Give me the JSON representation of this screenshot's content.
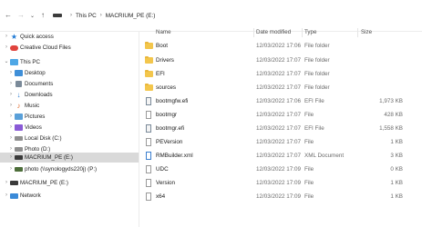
{
  "address": {
    "back_icon": "arrow-left-icon",
    "forward_icon": "arrow-right-icon",
    "recent_icon": "chevron-down-icon",
    "up_icon": "arrow-up-icon",
    "breadcrumb": [
      "This PC",
      "MACRIUM_PE (E:)"
    ]
  },
  "sidebar": {
    "items": [
      {
        "label": "Quick access",
        "icon": "star-icon",
        "expander": ">"
      },
      {
        "label": "Creative Cloud Files",
        "icon": "creative-cloud-icon",
        "expander": ">"
      },
      {
        "label": "This PC",
        "icon": "computer-icon",
        "expander": "v"
      },
      {
        "label": "Desktop",
        "icon": "desktop-folder-icon",
        "expander": ">"
      },
      {
        "label": "Documents",
        "icon": "documents-folder-icon",
        "expander": ">"
      },
      {
        "label": "Downloads",
        "icon": "downloads-icon",
        "expander": ">"
      },
      {
        "label": "Music",
        "icon": "music-icon",
        "expander": ">"
      },
      {
        "label": "Pictures",
        "icon": "pictures-folder-icon",
        "expander": ">"
      },
      {
        "label": "Videos",
        "icon": "videos-folder-icon",
        "expander": ">"
      },
      {
        "label": "Local Disk (C:)",
        "icon": "local-disk-icon",
        "expander": ">"
      },
      {
        "label": "Photo (D:)",
        "icon": "drive-icon",
        "expander": ">"
      },
      {
        "label": "MACRIUM_PE (E:)",
        "icon": "usb-drive-icon",
        "expander": ">"
      },
      {
        "label": "photo (\\\\synologyds220j) (P:)",
        "icon": "network-drive-icon",
        "expander": ">"
      },
      {
        "label": "MACRIUM_PE (E:)",
        "icon": "usb-drive-icon",
        "expander": ">"
      },
      {
        "label": "Network",
        "icon": "network-icon",
        "expander": ">"
      }
    ]
  },
  "columns": {
    "name": "Name",
    "date": "Date modified",
    "type": "Type",
    "size": "Size"
  },
  "files": [
    {
      "name": "Boot",
      "date": "12/03/2022 17:06",
      "type": "File folder",
      "size": "",
      "kind": "folder"
    },
    {
      "name": "Drivers",
      "date": "12/03/2022 17:07",
      "type": "File folder",
      "size": "",
      "kind": "folder"
    },
    {
      "name": "EFI",
      "date": "12/03/2022 17:07",
      "type": "File folder",
      "size": "",
      "kind": "folder"
    },
    {
      "name": "sources",
      "date": "12/03/2022 17:07",
      "type": "File folder",
      "size": "",
      "kind": "folder"
    },
    {
      "name": "bootmgfw.efi",
      "date": "12/03/2022 17:06",
      "type": "EFI File",
      "size": "1,973 KB",
      "kind": "efi"
    },
    {
      "name": "bootmgr",
      "date": "12/03/2022 17:07",
      "type": "File",
      "size": "428 KB",
      "kind": "file"
    },
    {
      "name": "bootmgr.efi",
      "date": "12/03/2022 17:07",
      "type": "EFI File",
      "size": "1,558 KB",
      "kind": "efi"
    },
    {
      "name": "PEVersion",
      "date": "12/03/2022 17:07",
      "type": "File",
      "size": "1 KB",
      "kind": "file"
    },
    {
      "name": "RMBuilder.xml",
      "date": "12/03/2022 17:07",
      "type": "XML Document",
      "size": "3 KB",
      "kind": "xml"
    },
    {
      "name": "UDC",
      "date": "12/03/2022 17:09",
      "type": "File",
      "size": "0 KB",
      "kind": "file"
    },
    {
      "name": "Version",
      "date": "12/03/2022 17:09",
      "type": "File",
      "size": "1 KB",
      "kind": "file"
    },
    {
      "name": "x64",
      "date": "12/03/2022 17:09",
      "type": "File",
      "size": "1 KB",
      "kind": "file"
    }
  ],
  "colors": {
    "folder": "#f3c64c",
    "selection": "#d9d9d9",
    "accent": "#1e79d4"
  }
}
